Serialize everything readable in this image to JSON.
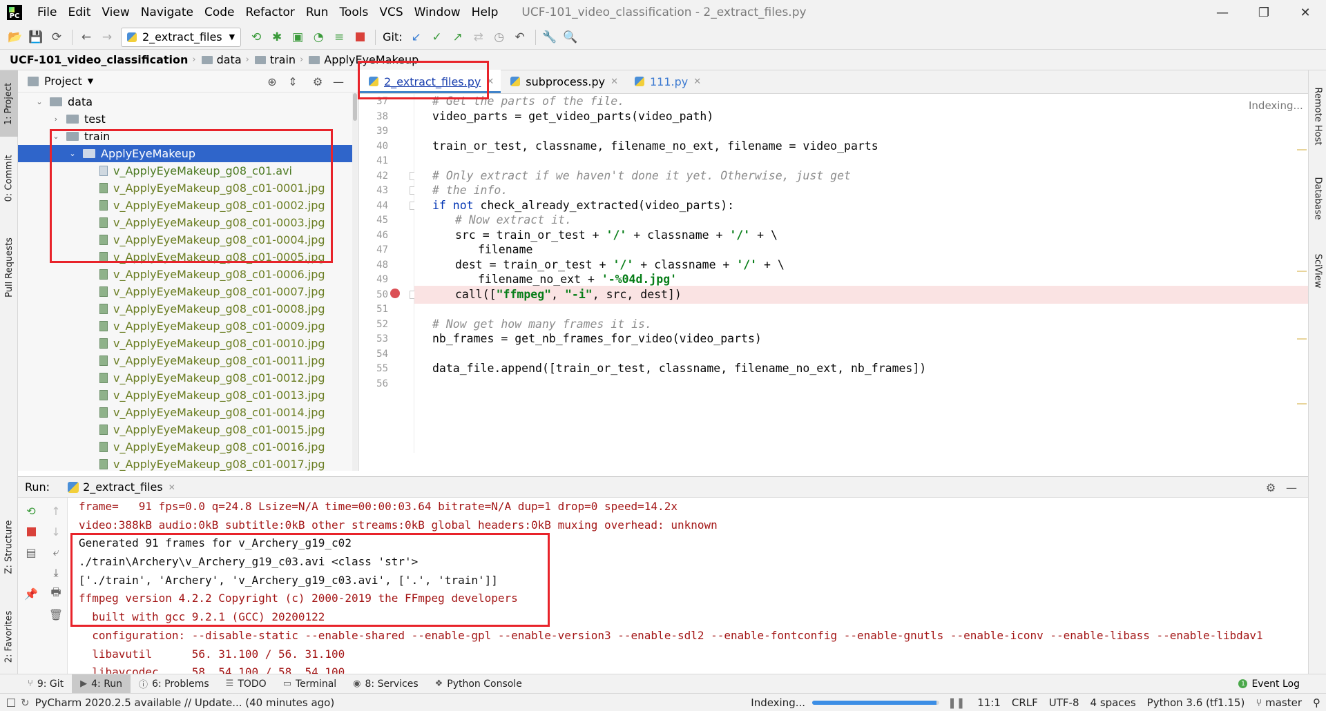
{
  "menu": {
    "items": [
      "File",
      "Edit",
      "View",
      "Navigate",
      "Code",
      "Refactor",
      "Run",
      "Tools",
      "VCS",
      "Window",
      "Help"
    ],
    "window_title": "UCF-101_video_classification - 2_extract_files.py"
  },
  "toolbar": {
    "run_config": "2_extract_files",
    "git_label": "Git:"
  },
  "breadcrumb": [
    "UCF-101_video_classification",
    "data",
    "train",
    "ApplyEyeMakeup"
  ],
  "left_tool_tabs": [
    "1: Project",
    "0: Commit",
    "Pull Requests",
    "Z: Structure",
    "2: Favorites"
  ],
  "right_tool_tabs": [
    "Remote Host",
    "Database",
    "SciView"
  ],
  "project": {
    "title": "Project",
    "tree": [
      {
        "name": "data",
        "kind": "folder",
        "level": 1,
        "open": true
      },
      {
        "name": "test",
        "kind": "folder",
        "level": 2,
        "open": false
      },
      {
        "name": "train",
        "kind": "folder",
        "level": 2,
        "open": true
      },
      {
        "name": "ApplyEyeMakeup",
        "kind": "folder",
        "level": 3,
        "open": true,
        "selected": true
      },
      {
        "name": "v_ApplyEyeMakeup_g08_c01.avi",
        "kind": "avi",
        "level": 4
      },
      {
        "name": "v_ApplyEyeMakeup_g08_c01-0001.jpg",
        "kind": "jpg",
        "level": 4
      },
      {
        "name": "v_ApplyEyeMakeup_g08_c01-0002.jpg",
        "kind": "jpg",
        "level": 4
      },
      {
        "name": "v_ApplyEyeMakeup_g08_c01-0003.jpg",
        "kind": "jpg",
        "level": 4
      },
      {
        "name": "v_ApplyEyeMakeup_g08_c01-0004.jpg",
        "kind": "jpg",
        "level": 4
      },
      {
        "name": "v_ApplyEyeMakeup_g08_c01-0005.jpg",
        "kind": "jpg",
        "level": 4
      },
      {
        "name": "v_ApplyEyeMakeup_g08_c01-0006.jpg",
        "kind": "jpg",
        "level": 4
      },
      {
        "name": "v_ApplyEyeMakeup_g08_c01-0007.jpg",
        "kind": "jpg",
        "level": 4
      },
      {
        "name": "v_ApplyEyeMakeup_g08_c01-0008.jpg",
        "kind": "jpg",
        "level": 4
      },
      {
        "name": "v_ApplyEyeMakeup_g08_c01-0009.jpg",
        "kind": "jpg",
        "level": 4
      },
      {
        "name": "v_ApplyEyeMakeup_g08_c01-0010.jpg",
        "kind": "jpg",
        "level": 4
      },
      {
        "name": "v_ApplyEyeMakeup_g08_c01-0011.jpg",
        "kind": "jpg",
        "level": 4
      },
      {
        "name": "v_ApplyEyeMakeup_g08_c01-0012.jpg",
        "kind": "jpg",
        "level": 4
      },
      {
        "name": "v_ApplyEyeMakeup_g08_c01-0013.jpg",
        "kind": "jpg",
        "level": 4
      },
      {
        "name": "v_ApplyEyeMakeup_g08_c01-0014.jpg",
        "kind": "jpg",
        "level": 4
      },
      {
        "name": "v_ApplyEyeMakeup_g08_c01-0015.jpg",
        "kind": "jpg",
        "level": 4
      },
      {
        "name": "v_ApplyEyeMakeup_g08_c01-0016.jpg",
        "kind": "jpg",
        "level": 4
      },
      {
        "name": "v_ApplyEyeMakeup_g08_c01-0017.jpg",
        "kind": "jpg",
        "level": 4
      }
    ]
  },
  "editor": {
    "tabs": [
      {
        "label": "2_extract_files.py",
        "active": true
      },
      {
        "label": "subprocess.py",
        "active": false
      },
      {
        "label": "111.py",
        "active": false
      }
    ],
    "indexing_hint": "Indexing...",
    "breakpoint_line": 50,
    "lines": [
      {
        "n": "37",
        "indent": 0,
        "tokens": [
          [
            "cm",
            "# Get the parts of the file."
          ]
        ]
      },
      {
        "n": "38",
        "indent": 0,
        "tokens": [
          [
            "tx",
            "video_parts = get_video_parts(video_path)"
          ]
        ]
      },
      {
        "n": "39",
        "indent": 0,
        "tokens": []
      },
      {
        "n": "40",
        "indent": 0,
        "tokens": [
          [
            "tx",
            "train_or_test, classname, filename_no_ext, filename = video_parts"
          ]
        ]
      },
      {
        "n": "41",
        "indent": 0,
        "tokens": []
      },
      {
        "n": "42",
        "indent": 0,
        "tokens": [
          [
            "cm",
            "# Only extract if we haven't done it yet. Otherwise, just get"
          ]
        ]
      },
      {
        "n": "43",
        "indent": 0,
        "tokens": [
          [
            "cm",
            "# the info."
          ]
        ]
      },
      {
        "n": "44",
        "indent": 0,
        "tokens": [
          [
            "kw",
            "if not "
          ],
          [
            "tx",
            "check_already_extracted(video_parts):"
          ]
        ]
      },
      {
        "n": "45",
        "indent": 1,
        "tokens": [
          [
            "cm",
            "# Now extract it."
          ]
        ]
      },
      {
        "n": "46",
        "indent": 1,
        "tokens": [
          [
            "tx",
            "src = train_or_test + "
          ],
          [
            "st",
            "'/'"
          ],
          [
            "tx",
            " + classname + "
          ],
          [
            "st",
            "'/'"
          ],
          [
            "tx",
            " + \\"
          ]
        ]
      },
      {
        "n": "47",
        "indent": 2,
        "tokens": [
          [
            "tx",
            "filename"
          ]
        ]
      },
      {
        "n": "48",
        "indent": 1,
        "tokens": [
          [
            "tx",
            "dest = train_or_test + "
          ],
          [
            "st",
            "'/'"
          ],
          [
            "tx",
            " + classname + "
          ],
          [
            "st",
            "'/'"
          ],
          [
            "tx",
            " + \\"
          ]
        ]
      },
      {
        "n": "49",
        "indent": 2,
        "tokens": [
          [
            "tx",
            "filename_no_ext + "
          ],
          [
            "st",
            "'-%04d.jpg'"
          ]
        ]
      },
      {
        "n": "50",
        "indent": 1,
        "tokens": [
          [
            "tx",
            "call(["
          ],
          [
            "st",
            "\"ffmpeg\""
          ],
          [
            "tx",
            ", "
          ],
          [
            "st",
            "\"-i\""
          ],
          [
            "tx",
            ", src, dest])"
          ]
        ]
      },
      {
        "n": "51",
        "indent": 0,
        "tokens": []
      },
      {
        "n": "52",
        "indent": 0,
        "tokens": [
          [
            "cm",
            "# Now get how many frames it is."
          ]
        ]
      },
      {
        "n": "53",
        "indent": 0,
        "tokens": [
          [
            "tx",
            "nb_frames = get_nb_frames_for_video(video_parts)"
          ]
        ]
      },
      {
        "n": "54",
        "indent": 0,
        "tokens": []
      },
      {
        "n": "55",
        "indent": 0,
        "tokens": [
          [
            "tx",
            "data_file.append([train_or_test, classname, filename_no_ext, nb_frames])"
          ]
        ]
      },
      {
        "n": "56",
        "indent": 0,
        "tokens": []
      }
    ]
  },
  "run": {
    "label": "Run:",
    "tab": "2_extract_files",
    "console": [
      {
        "kind": "err",
        "text": "frame=   91 fps=0.0 q=24.8 Lsize=N/A time=00:00:03.64 bitrate=N/A dup=1 drop=0 speed=14.2x"
      },
      {
        "kind": "err",
        "text": "video:388kB audio:0kB subtitle:0kB other streams:0kB global headers:0kB muxing overhead: unknown"
      },
      {
        "kind": "out",
        "text": "Generated 91 frames for v_Archery_g19_c02"
      },
      {
        "kind": "out",
        "text": "./train\\Archery\\v_Archery_g19_c03.avi <class 'str'>"
      },
      {
        "kind": "out",
        "text": "['./train', 'Archery', 'v_Archery_g19_c03.avi', ['.', 'train']]"
      },
      {
        "kind": "err",
        "text": "ffmpeg version 4.2.2 Copyright (c) 2000-2019 the FFmpeg developers"
      },
      {
        "kind": "err",
        "text": "  built with gcc 9.2.1 (GCC) 20200122"
      },
      {
        "kind": "err",
        "text": "  configuration: --disable-static --enable-shared --enable-gpl --enable-version3 --enable-sdl2 --enable-fontconfig --enable-gnutls --enable-iconv --enable-libass --enable-libdav1"
      },
      {
        "kind": "err",
        "text": "  libavutil      56. 31.100 / 56. 31.100"
      },
      {
        "kind": "err",
        "text": "  libavcodec     58. 54.100 / 58. 54.100"
      }
    ]
  },
  "bottom_tools": [
    {
      "label": "9: Git",
      "icon": "git-icon"
    },
    {
      "label": "4: Run",
      "icon": "run-icon",
      "active": true
    },
    {
      "label": "6: Problems",
      "icon": "problems-icon"
    },
    {
      "label": "TODO",
      "icon": "todo-icon"
    },
    {
      "label": "Terminal",
      "icon": "terminal-icon"
    },
    {
      "label": "8: Services",
      "icon": "services-icon"
    },
    {
      "label": "Python Console",
      "icon": "python-console-icon"
    }
  ],
  "event_log": "Event Log",
  "status": {
    "message": "PyCharm 2020.2.5 available // Update... (40 minutes ago)",
    "indexing": "Indexing...",
    "indexing_progress": 0.98,
    "position": "11:1",
    "line_separator": "CRLF",
    "encoding": "UTF-8",
    "indent": "4 spaces",
    "interpreter": "Python 3.6 (tf1.15)",
    "branch": "master"
  },
  "colors": {
    "selection": "#2f65ca",
    "highlight_box": "#e8232a",
    "comment": "#8c8c8c",
    "keyword": "#0033b3",
    "string": "#067d17",
    "console_stderr": "#a31515"
  }
}
